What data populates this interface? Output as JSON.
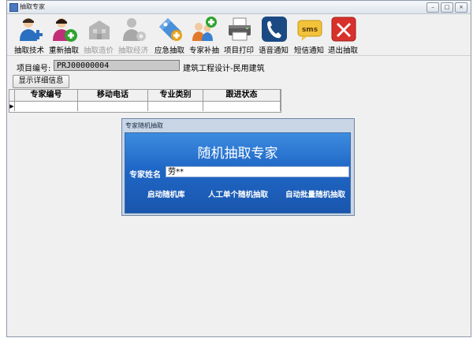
{
  "window": {
    "title": "抽取专家"
  },
  "toolbar": {
    "items": [
      {
        "label": "抽取技术",
        "icon": "person-add-icon",
        "enabled": true
      },
      {
        "label": "重新抽取",
        "icon": "person-plus-icon",
        "enabled": true
      },
      {
        "label": "抽取造价",
        "icon": "building-icon",
        "enabled": false
      },
      {
        "label": "抽取经济",
        "icon": "person-gear-icon",
        "enabled": false
      },
      {
        "label": "应急抽取",
        "icon": "tag-plus-icon",
        "enabled": true
      },
      {
        "label": "专家补抽",
        "icon": "people-plus-icon",
        "enabled": true
      },
      {
        "label": "项目打印",
        "icon": "printer-icon",
        "enabled": true
      },
      {
        "label": "语音通知",
        "icon": "phone-icon",
        "enabled": true
      },
      {
        "label": "短信通知",
        "icon": "sms-icon",
        "enabled": true
      },
      {
        "label": "退出抽取",
        "icon": "close-icon",
        "enabled": true
      }
    ]
  },
  "project": {
    "label": "项目编号:",
    "code": "PRJ00000004",
    "name": "建筑工程设计-民用建筑"
  },
  "detail_button": "显示详细信息",
  "table": {
    "headers": [
      "专家编号",
      "移动电话",
      "专业类别",
      "跟进状态"
    ],
    "rows": [
      [
        "",
        "",
        "",
        ""
      ]
    ]
  },
  "dialog": {
    "title": "专家随机抽取",
    "heading": "随机抽取专家",
    "name_label": "专家姓名",
    "name_value": "劳**",
    "actions": [
      "启动随机库",
      "人工单个随机抽取",
      "自动批量随机抽取"
    ]
  },
  "colors": {
    "dialog_blue": "#1f67c6",
    "close_red": "#d8312b",
    "phone_blue": "#1b4a83",
    "sms_yellow": "#f2c33a",
    "plus_green": "#2fa32f"
  }
}
